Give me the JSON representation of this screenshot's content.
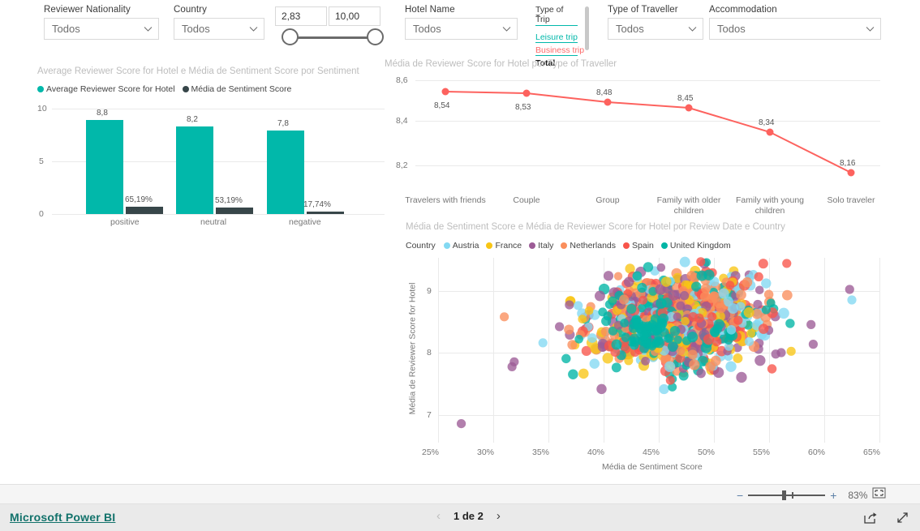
{
  "slicers": {
    "reviewer_nationality": {
      "label": "Reviewer Nationality",
      "value": "Todos"
    },
    "country": {
      "label": "Country",
      "value": "Todos"
    },
    "score_range": {
      "min": "2,83",
      "max": "10,00"
    },
    "hotel_name": {
      "label": "Hotel Name",
      "value": "Todos"
    },
    "type_of_trip": {
      "label": "Type of Trip",
      "items": [
        {
          "label": "Leisure trip",
          "color": "#01b8aa"
        },
        {
          "label": "Business trip",
          "color": "#fd6b6b"
        },
        {
          "label": "Total",
          "color": "#1a1a1a"
        }
      ]
    },
    "type_of_traveller": {
      "label": "Type of Traveller",
      "value": "Todos"
    },
    "accommodation": {
      "label": "Accommodation",
      "value": "Todos"
    }
  },
  "chart_data": [
    {
      "type": "bar",
      "title": "Average Reviewer Score for Hotel e Média de Sentiment Score por Sentiment",
      "categories": [
        "positive",
        "neutral",
        "negative"
      ],
      "series": [
        {
          "name": "Average Reviewer Score for Hotel",
          "color": "#01b8aa",
          "values": [
            8.8,
            8.2,
            7.8
          ],
          "labels": [
            "8,8",
            "8,2",
            "7,8"
          ]
        },
        {
          "name": "Média de Sentiment Score",
          "color": "#374649",
          "values": [
            0.6519,
            0.5319,
            0.1774
          ],
          "labels": [
            "65,19%",
            "53,19%",
            "17,74%"
          ]
        }
      ],
      "ylabel": "",
      "xlabel": "",
      "yticks": [
        "0",
        "5",
        "10"
      ],
      "ylim": [
        0,
        10
      ],
      "grid": true,
      "legend_position": "top"
    },
    {
      "type": "line",
      "title": "Média de Reviewer Score for Hotel por Type of Traveller",
      "categories": [
        "Travelers with friends",
        "Couple",
        "Group",
        "Family with older children",
        "Family with young children",
        "Solo traveler"
      ],
      "values": [
        8.54,
        8.53,
        8.48,
        8.45,
        8.34,
        8.16
      ],
      "labels": [
        "8,54",
        "8,53",
        "8,48",
        "8,45",
        "8,34",
        "8,16"
      ],
      "color": "#fd625e",
      "yticks": [
        "8,2",
        "8,4",
        "8,6"
      ],
      "ylim": [
        8.1,
        8.62
      ],
      "xlabel": "",
      "ylabel": "",
      "grid": true,
      "legend_position": "none"
    },
    {
      "type": "scatter",
      "title": "Média de Sentiment Score e Média de Reviewer Score for Hotel por Review Date e Country",
      "xlabel": "Média de Sentiment Score",
      "ylabel": "Média de Reviewer Score for Hotel",
      "legend_title": "Country",
      "legend_position": "top",
      "xticks": [
        "25%",
        "30%",
        "35%",
        "40%",
        "45%",
        "50%",
        "55%",
        "60%",
        "65%"
      ],
      "yticks": [
        "7",
        "8",
        "9"
      ],
      "xlim": [
        0.25,
        0.65
      ],
      "ylim": [
        6.72,
        9.35
      ],
      "grid": true,
      "series": [
        {
          "name": "Austria",
          "color": "#83d9f2"
        },
        {
          "name": "France",
          "color": "#f8c514"
        },
        {
          "name": "Italy",
          "color": "#9c5b96"
        },
        {
          "name": "Netherlands",
          "color": "#fa8e5c"
        },
        {
          "name": "Spain",
          "color": "#f8544a"
        },
        {
          "name": "United Kingdom",
          "color": "#00b5a5"
        }
      ]
    }
  ],
  "footer": {
    "brand": "Microsoft Power BI",
    "page_indicator": "1 de 2",
    "prev_icon": "chevron-left-icon",
    "next_icon": "chevron-right-icon",
    "zoom_level": "83%",
    "zoom_out_icon": "minus-icon",
    "zoom_in_icon": "plus-icon",
    "fit_icon": "fit-to-page-icon",
    "share_icon": "share-icon",
    "fullscreen_icon": "fullscreen-icon"
  }
}
